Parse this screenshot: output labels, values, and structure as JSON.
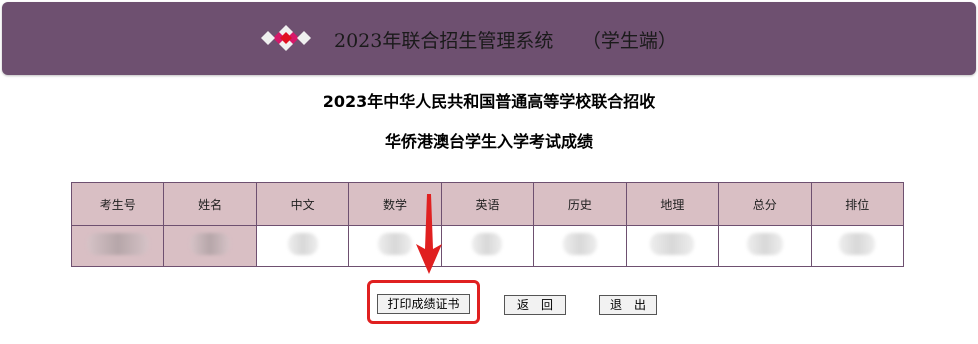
{
  "header": {
    "title": "2023年联合招生管理系统　　（学生端）",
    "logo_icon": "diamond-logo-icon",
    "background_color": "#6e5070"
  },
  "page": {
    "heading_line1": "2023年中华人民共和国普通高等学校联合招收",
    "heading_line2": "华侨港澳台学生入学考试成绩"
  },
  "table": {
    "columns": [
      "考生号",
      "姓名",
      "中文",
      "数学",
      "英语",
      "历史",
      "地理",
      "总分",
      "排位"
    ],
    "row_values": "redacted (blurred)",
    "header_color": "#d9bfc4"
  },
  "buttons": {
    "print_label": "打印成绩证书",
    "back_label": "返　回",
    "exit_label": "退　出"
  },
  "annotation": {
    "highlight_color": "#e02020",
    "arrow_icon": "red-arrow-down-icon"
  }
}
